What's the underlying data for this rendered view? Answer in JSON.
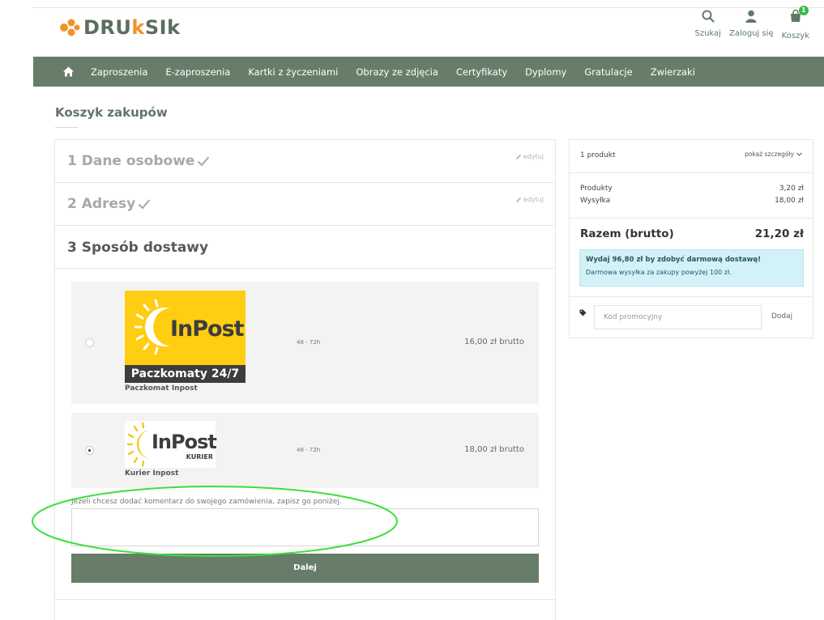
{
  "header": {
    "logo_text_left": "DRU",
    "logo_text_k": "k",
    "logo_text_right": "SIk",
    "icons": [
      {
        "icon": "search-icon",
        "label": "Szukaj"
      },
      {
        "icon": "user-icon",
        "label": "Zaloguj się"
      },
      {
        "icon": "bag-icon",
        "label": "Koszyk",
        "badge": "1"
      }
    ]
  },
  "nav": {
    "home_icon": "home-icon",
    "items": [
      "Zaproszenia",
      "E-zaproszenia",
      "Kartki z życzeniami",
      "Obrazy ze zdjęcia",
      "Certyfikaty",
      "Dyplomy",
      "Gratulacje",
      "Zwierzaki"
    ]
  },
  "page_title": "Koszyk zakupów",
  "steps": {
    "step1": {
      "title": "1 Dane osobowe",
      "edit": "edytuj"
    },
    "step2": {
      "title": "2 Adresy",
      "edit": "edytuj"
    },
    "step3": {
      "title": "3 Sposób dostawy"
    }
  },
  "carriers": [
    {
      "name": "Paczkomat Inpost",
      "delay": "48 - 72h",
      "price": "16,00 zł brutto",
      "logo_brand": "InPost",
      "logo_band": "Paczkomaty 24/7",
      "selected": false
    },
    {
      "name": "Kurier Inpost",
      "delay": "48 - 72h",
      "price": "18,00 zł brutto",
      "logo_brand": "InPost",
      "logo_sub": "KURIER",
      "selected": true
    }
  ],
  "comment": {
    "label": "Jeżeli chcesz dodać komentarz do swojego zamówienia, zapisz go poniżej.",
    "value": ""
  },
  "next_button": "Dalej",
  "summary": {
    "count": "1 produkt",
    "details": "pokaż szczegóły",
    "products_label": "Produkty",
    "products_value": "3,20 zł",
    "shipping_label": "Wysyłka",
    "shipping_value": "18,00 zł",
    "total_label": "Razem (brutto)",
    "total_value": "21,20 zł",
    "free_ship_line1": "Wydaj 96,80 zł by zdobyć darmową dostawę!",
    "free_ship_line2": "Darmowa wysyłka za zakupy powyżej 100 zł.",
    "promo_icon": "tag-icon",
    "promo_placeholder": "Kod promocyjny",
    "promo_button": "Dodaj"
  },
  "colors": {
    "brand_green": "#687d69",
    "accent_orange": "#f0932b",
    "inpost_yellow": "#ffcd11",
    "annotation_green": "#3be03b"
  }
}
